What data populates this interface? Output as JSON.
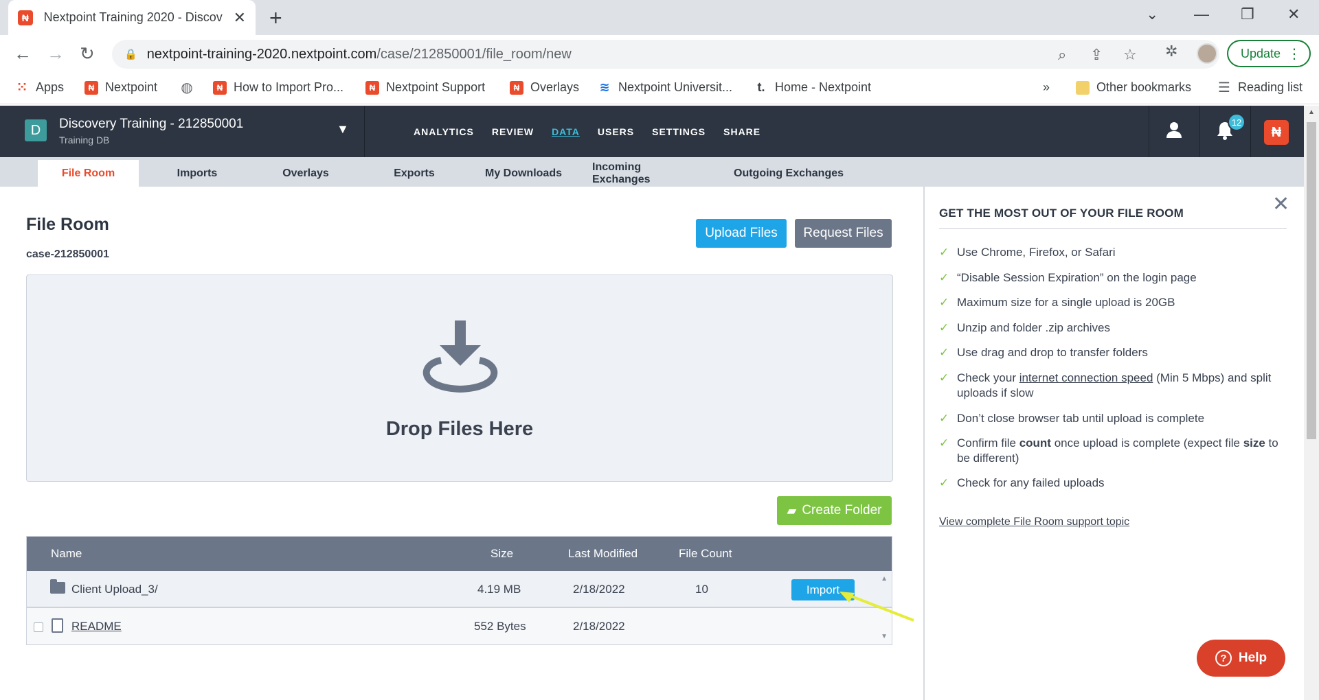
{
  "browser": {
    "tab_title": "Nextpoint Training 2020 - Discov",
    "url_host": "nextpoint-training-2020.nextpoint.com",
    "url_path": "/case/212850001/file_room/new",
    "update_label": "Update"
  },
  "bookmarks": [
    {
      "label": "Apps",
      "icon": "apps-grid-icon"
    },
    {
      "label": "Nextpoint",
      "icon": "nextpoint-icon"
    },
    {
      "label": "",
      "icon": "globe-icon"
    },
    {
      "label": "How to Import Pro...",
      "icon": "nextpoint-icon"
    },
    {
      "label": "Nextpoint Support",
      "icon": "nextpoint-icon"
    },
    {
      "label": "Overlays",
      "icon": "nextpoint-icon"
    },
    {
      "label": "Nextpoint Universit...",
      "icon": "wave-icon"
    },
    {
      "label": "Home - Nextpoint",
      "icon": "t-icon"
    }
  ],
  "bookmarks_right": {
    "more": "»",
    "other": "Other bookmarks",
    "reading": "Reading list"
  },
  "app": {
    "case_initial": "D",
    "case_name": "Discovery Training - 212850001",
    "case_db": "Training DB",
    "nav": [
      "ANALYTICS",
      "REVIEW",
      "DATA",
      "USERS",
      "SETTINGS",
      "SHARE"
    ],
    "notification_count": "12"
  },
  "subnav": [
    "File Room",
    "Imports",
    "Overlays",
    "Exports",
    "My Downloads",
    "Incoming Exchanges",
    "Outgoing Exchanges"
  ],
  "main": {
    "title": "File Room",
    "case_code": "case-212850001",
    "upload_label": "Upload Files",
    "request_label": "Request Files",
    "drop_text": "Drop Files Here",
    "create_folder_label": "Create Folder",
    "table": {
      "headers": [
        "Name",
        "Size",
        "Last Modified",
        "File Count"
      ],
      "rows": [
        {
          "name": "Client Upload_3/",
          "size": "4.19 MB",
          "modified": "2/18/2022",
          "count": "10",
          "action": "Import"
        },
        {
          "name": "README",
          "size": "552 Bytes",
          "modified": "2/18/2022",
          "count": "",
          "action": ""
        }
      ]
    }
  },
  "panel": {
    "title": "GET THE MOST OUT OF YOUR FILE ROOM",
    "tips": [
      "Use Chrome, Firefox, or Safari",
      "“Disable Session Expiration” on the login page",
      "Maximum size for a single upload is 20GB",
      "Unzip and folder .zip archives",
      "Use drag and drop to transfer folders"
    ],
    "tip_speed": {
      "before": "Check your ",
      "link": "internet connection speed",
      "after": " (Min 5 Mbps) and split uploads if slow"
    },
    "tip_tab": "Don’t close browser tab until upload is complete",
    "tip_count": {
      "a": "Confirm file ",
      "b": "count",
      "c": " once upload is complete (expect file ",
      "d": "size",
      "e": " to be different)"
    },
    "tip_failed": "Check for any failed uploads",
    "link": "View complete File Room support topic"
  },
  "help_label": "Help",
  "colors": {
    "brand": "#e94b2c",
    "header": "#2c3541",
    "accent": "#1ea5e8",
    "green": "#7dc443"
  }
}
